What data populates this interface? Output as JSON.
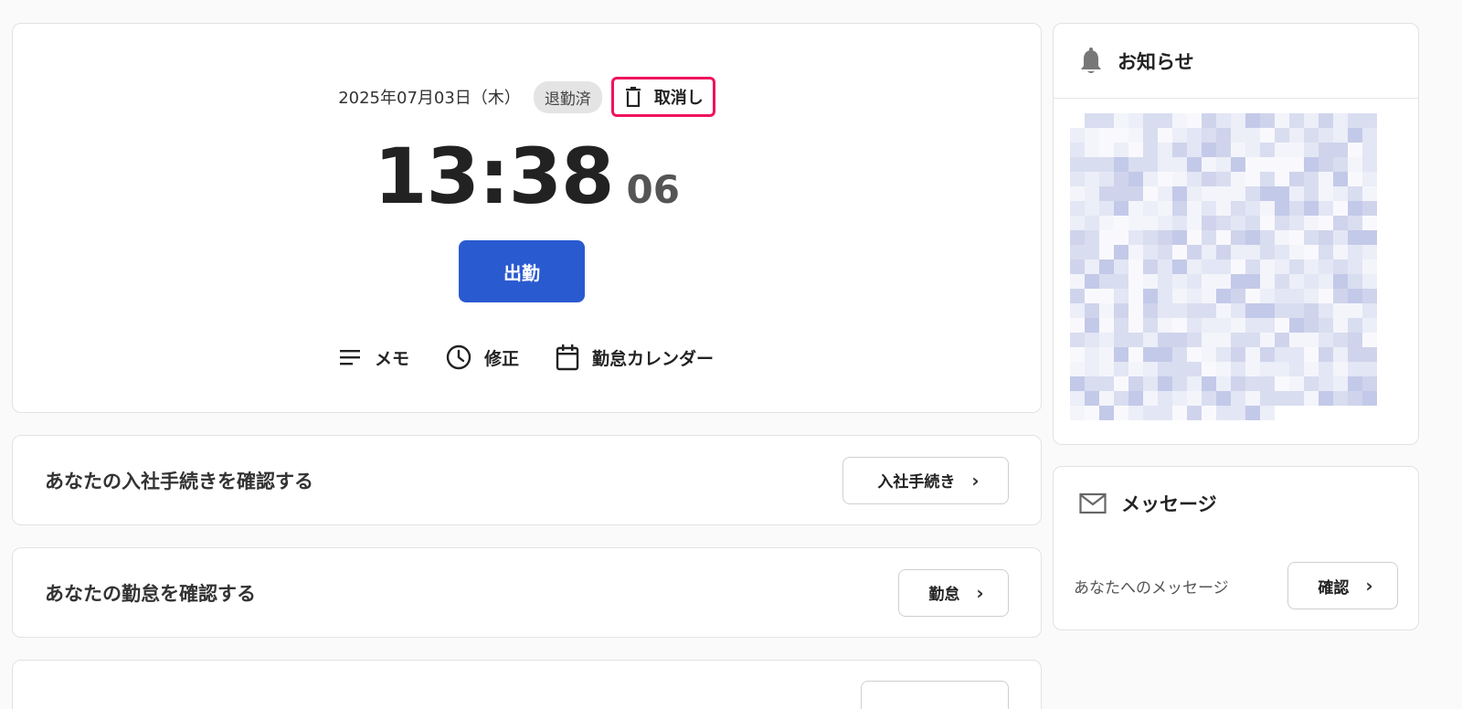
{
  "punch": {
    "date": "2025年07月03日（木）",
    "status": "退勤済",
    "cancel_label": "取消し",
    "clock_hm": "13:38",
    "clock_seconds": "06",
    "punch_button": "出勤",
    "actions": {
      "memo": "メモ",
      "correct": "修正",
      "calendar": "勤怠カレンダー"
    }
  },
  "cards": [
    {
      "title": "あなたの入社手続きを確認する",
      "button": "入社手続き"
    },
    {
      "title": "あなたの勤怠を確認する",
      "button": "勤怠"
    }
  ],
  "sidebar": {
    "news": {
      "title": "お知らせ"
    },
    "messages": {
      "title": "メッセージ",
      "text": "あなたへのメッセージ",
      "button": "確認"
    }
  },
  "colors": {
    "primary": "#2a5ad0",
    "highlight": "#f0125c",
    "badge_bg": "#e4e4e4"
  },
  "icons": [
    "trash-icon",
    "memo-lines-icon",
    "clock-icon",
    "calendar-icon",
    "bell-icon",
    "mail-icon",
    "chevron-right-icon"
  ]
}
